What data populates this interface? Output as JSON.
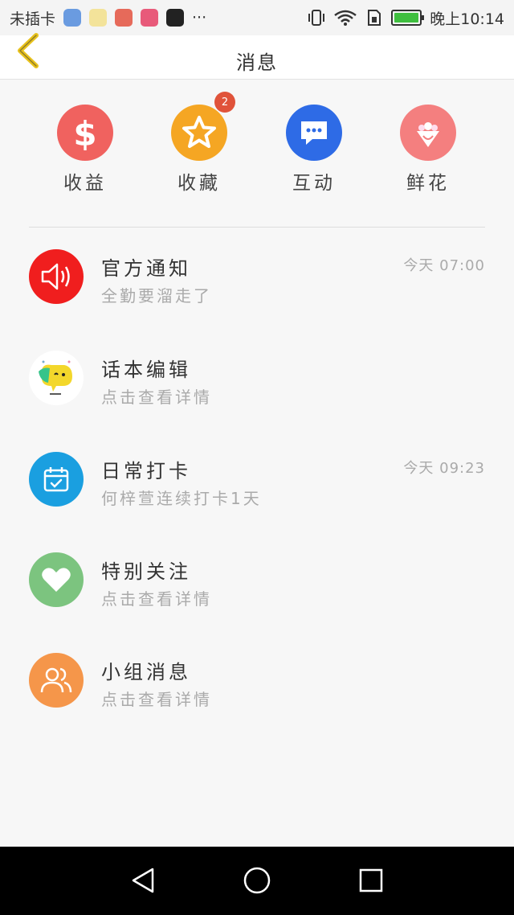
{
  "status_bar": {
    "carrier": "未插卡",
    "app_icons": [
      {
        "icon": "location-icon",
        "color": "#6a9be0"
      },
      {
        "icon": "bee-icon",
        "color": "#e8c64a"
      },
      {
        "icon": "music-icon",
        "color": "#e66a5a"
      },
      {
        "icon": "gallery-icon",
        "color": "#e85a7a"
      },
      {
        "icon": "tiktok-icon",
        "color": "#222222"
      }
    ],
    "more": "···",
    "time": "晚上10:14",
    "battery_level": 1.0
  },
  "header": {
    "title": "消息"
  },
  "categories": [
    {
      "label": "收益",
      "icon": "dollar-icon",
      "color": "#f0625f",
      "badge": ""
    },
    {
      "label": "收藏",
      "icon": "star-icon",
      "color": "#f5a623",
      "badge": "2"
    },
    {
      "label": "互动",
      "icon": "chat-bubble-icon",
      "color": "#2e6be6",
      "badge": ""
    },
    {
      "label": "鲜花",
      "icon": "flower-icon",
      "color": "#f47f7f",
      "badge": ""
    }
  ],
  "messages": [
    {
      "title": "官方通知",
      "subtitle": "全勤要溜走了",
      "time": "今天 07:00",
      "icon": "speaker-icon",
      "color": "#f01e1e"
    },
    {
      "title": "话本编辑",
      "subtitle": "点击查看详情",
      "time": "",
      "icon": "editor-avatar-icon",
      "color": "#ffffff"
    },
    {
      "title": "日常打卡",
      "subtitle": "何梓萱连续打卡1天",
      "time": "今天 09:23",
      "icon": "calendar-check-icon",
      "color": "#1a9fe0"
    },
    {
      "title": "特别关注",
      "subtitle": "点击查看详情",
      "time": "",
      "icon": "heart-icon",
      "color": "#7cc47f"
    },
    {
      "title": "小组消息",
      "subtitle": "点击查看详情",
      "time": "",
      "icon": "group-icon",
      "color": "#f5964a"
    }
  ]
}
